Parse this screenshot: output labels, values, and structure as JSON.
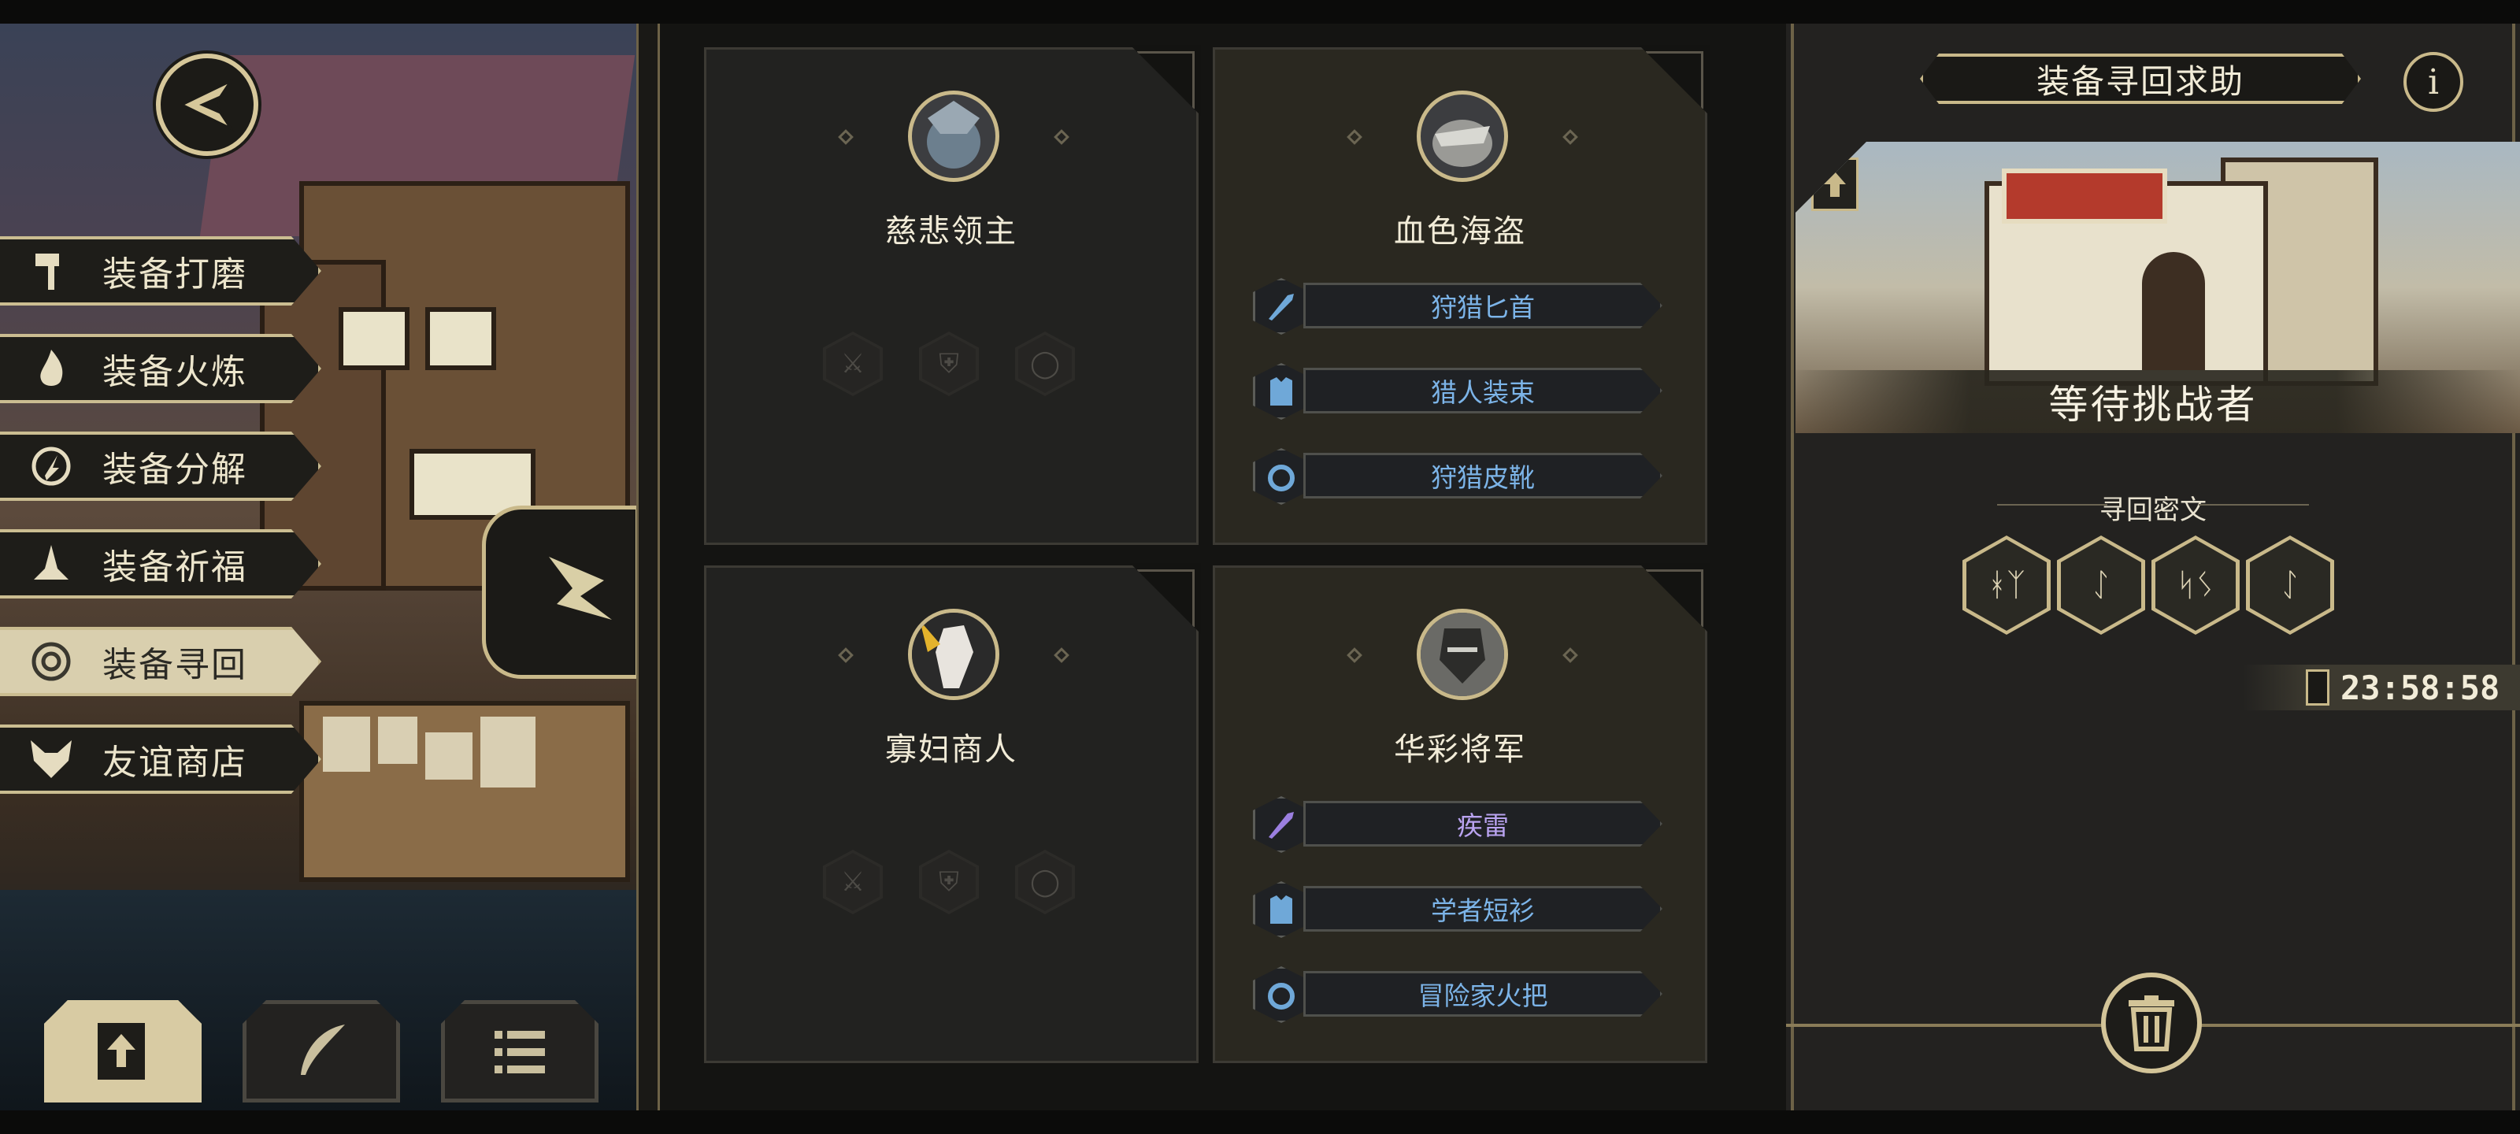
{
  "menu": {
    "items": [
      {
        "label": "装备打磨",
        "icon": "hammer-icon",
        "active": false
      },
      {
        "label": "装备火炼",
        "icon": "flame-icon",
        "active": false
      },
      {
        "label": "装备分解",
        "icon": "decompose-icon",
        "active": false
      },
      {
        "label": "装备祈福",
        "icon": "pray-hands-icon",
        "active": false
      },
      {
        "label": "装备寻回",
        "icon": "target-icon",
        "active": true
      },
      {
        "label": "友谊商店",
        "icon": "fox-icon",
        "active": false
      }
    ]
  },
  "bosses": [
    {
      "name": "慈悲领主",
      "items": []
    },
    {
      "name": "血色海盗",
      "items": [
        {
          "name": "狩猎匕首",
          "type": "dagger-icon"
        },
        {
          "name": "猎人装束",
          "type": "armor-icon"
        },
        {
          "name": "狩猎皮靴",
          "type": "ring-icon"
        }
      ]
    },
    {
      "name": "寡妇商人",
      "items": []
    },
    {
      "name": "华彩将军",
      "items": [
        {
          "name": "疾雷",
          "type": "dagger-icon",
          "rarity": "purple"
        },
        {
          "name": "学者短衫",
          "type": "armor-icon"
        },
        {
          "name": "冒险家火把",
          "type": "ring-icon"
        }
      ]
    }
  ],
  "panel": {
    "title": "装备寻回求助",
    "status": "等待挑战者",
    "secret_title": "寻回密文",
    "runes": [
      "ᚼᛉ",
      "ᛇ",
      "ᛋᛊ",
      "ᛇ"
    ],
    "timer": "23:58:58"
  },
  "colors": {
    "gold": "#c9b98a",
    "item_blue": "#7cb4e8",
    "item_purple": "#b9a3f0"
  }
}
